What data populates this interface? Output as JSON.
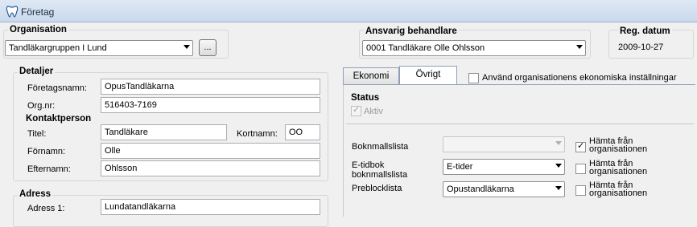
{
  "window": {
    "title": "Företag"
  },
  "organisation": {
    "title": "Organisation",
    "selected": "Tandläkargruppen I Lund",
    "browse_label": "..."
  },
  "ansvarig": {
    "title": "Ansvarig behandlare",
    "selected": "0001 Tandläkare Olle Ohlsson"
  },
  "reg": {
    "title": "Reg. datum",
    "value": "2009-10-27"
  },
  "detaljer": {
    "title": "Detaljer",
    "foretagsnamn_label": "Företagsnamn:",
    "foretagsnamn": "OpusTandläkarna",
    "orgnr_label": "Org.nr:",
    "orgnr": "516403-7169"
  },
  "kontaktperson": {
    "title": "Kontaktperson",
    "titel_label": "Titel:",
    "titel": "Tandläkare",
    "kortnamn_label": "Kortnamn:",
    "kortnamn": "OO",
    "fornamn_label": "Förnamn:",
    "fornamn": "Olle",
    "efternamn_label": "Efternamn:",
    "efternamn": "Ohlsson"
  },
  "adress": {
    "title": "Adress",
    "adress1_label": "Adress 1:",
    "adress1": "Lundatandläkarna"
  },
  "tabs": [
    {
      "label": "Ekonomi"
    },
    {
      "label": "Övrigt"
    }
  ],
  "use_org_econ": {
    "label": "Använd organisationens ekonomiska inställningar",
    "checked": false
  },
  "status": {
    "title": "Status",
    "aktiv_label": "Aktiv",
    "aktiv_checked": true
  },
  "lists": {
    "boknmallslista_label": "Boknmallslista",
    "boknmallslista_value": "",
    "boknmallslista_fetch": "Hämta från organisationen",
    "boknmallslista_fetch_checked": true,
    "etidbok_label": "E-tidbok boknmallslista",
    "etidbok_value": "E-tider",
    "etidbok_fetch": "Hämta från organisationen",
    "etidbok_fetch_checked": false,
    "preblock_label": "Preblocklista",
    "preblock_value": "Opustandläkarna",
    "preblock_fetch": "Hämta från organisationen",
    "preblock_fetch_checked": false
  },
  "colors": {
    "titlebar": "#c9d9ec",
    "panel": "#f0f0f0"
  }
}
